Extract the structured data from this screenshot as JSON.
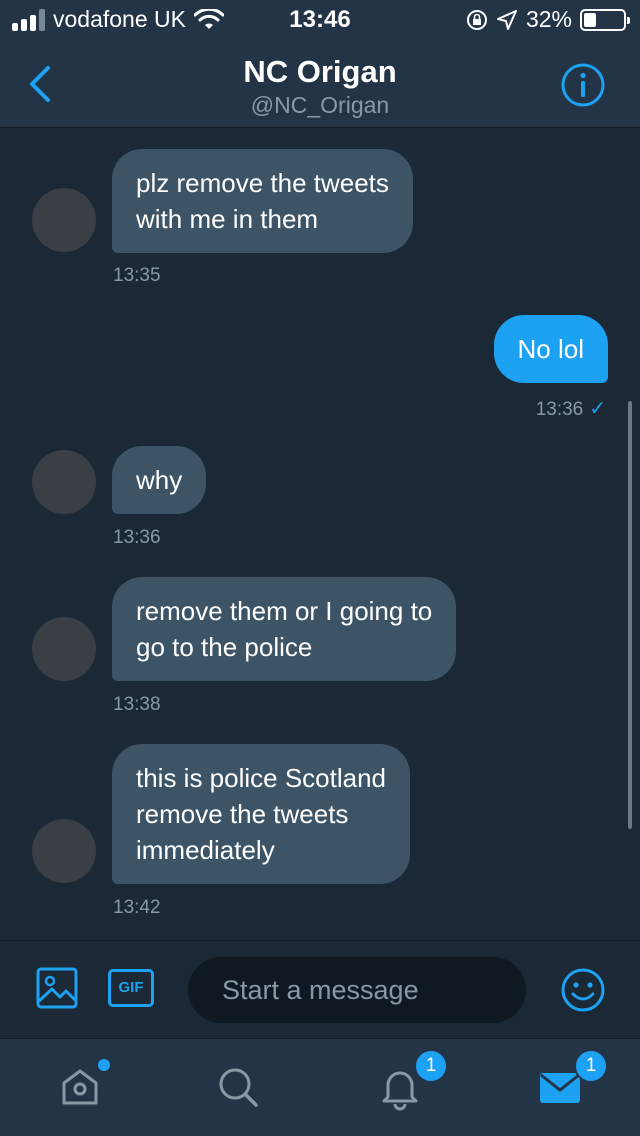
{
  "status_bar": {
    "carrier": "vodafone UK",
    "time": "13:46",
    "battery": "32%",
    "battery_level": 0.32
  },
  "header": {
    "title": "NC Origan",
    "handle": "@NC_Origan"
  },
  "messages": [
    {
      "direction": "in",
      "lines": [
        "plz remove the tweets",
        "with me in them"
      ],
      "time": "13:35"
    },
    {
      "direction": "out",
      "lines": [
        "No lol"
      ],
      "time": "13:36"
    },
    {
      "direction": "in",
      "lines": [
        "why"
      ],
      "time": "13:36"
    },
    {
      "direction": "in",
      "lines": [
        "remove them or I going to",
        "go to the police"
      ],
      "time": "13:38"
    },
    {
      "direction": "in",
      "lines": [
        "this is police Scotland",
        "remove the tweets",
        "immediately"
      ],
      "time": "13:42"
    }
  ],
  "composer": {
    "gif_label": "GIF",
    "placeholder": "Start a message"
  },
  "tabbar": {
    "notifications_badge": "1",
    "messages_badge": "1"
  },
  "colors": {
    "background": "#1b2836",
    "bar": "#243447",
    "accent": "#1da1f2",
    "incoming_bubble": "#3d5466",
    "muted_text": "#8899a6"
  },
  "icons": {
    "back": "chevron-left-icon",
    "info": "info-icon",
    "image": "image-icon",
    "emoji": "emoji-icon",
    "home": "home-icon",
    "search": "search-icon",
    "notifications": "bell-icon",
    "messages": "envelope-icon"
  }
}
